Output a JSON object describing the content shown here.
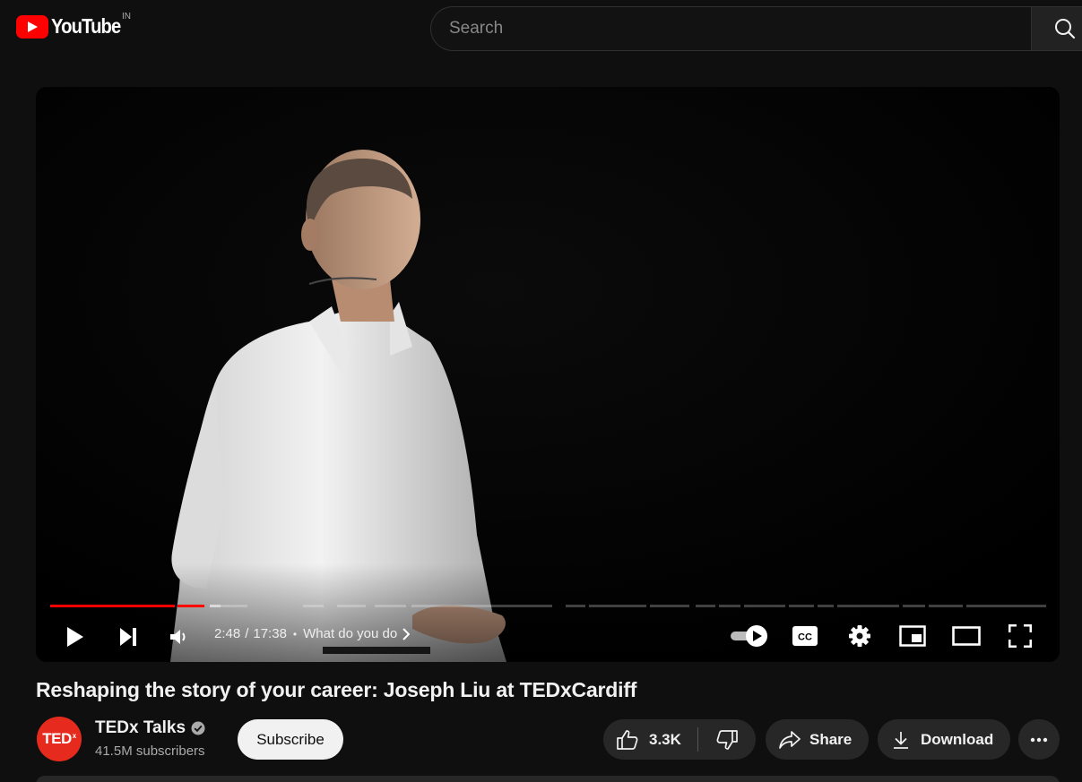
{
  "brand": {
    "logo_text": "YouTube",
    "region": "IN",
    "accent_color": "#ff0000"
  },
  "search": {
    "placeholder": "Search",
    "value": ""
  },
  "player": {
    "time_current": "2:48",
    "time_separator": "/",
    "time_total": "17:38",
    "chapter_title": "What do you do",
    "progress_fraction": 0.159,
    "buffered_fraction": 0.171,
    "autoplay": "on",
    "icons": [
      "play-icon",
      "next-icon",
      "volume-icon",
      "autoplay-toggle-icon",
      "captions-icon",
      "settings-gear-icon",
      "miniplayer-icon",
      "theater-mode-icon",
      "fullscreen-icon"
    ],
    "captions_label": "CC"
  },
  "video": {
    "title": "Reshaping the story of your career: Joseph Liu at TEDxCardiff"
  },
  "channel": {
    "avatar_text": "TED",
    "avatar_superscript": "x",
    "avatar_color": "#e62b1e",
    "name": "TEDx Talks",
    "verified": true,
    "subscribers": "41.5M subscribers"
  },
  "actions": {
    "subscribe_label": "Subscribe",
    "like_count": "3.3K",
    "share_label": "Share",
    "download_label": "Download",
    "more_label": "···"
  }
}
